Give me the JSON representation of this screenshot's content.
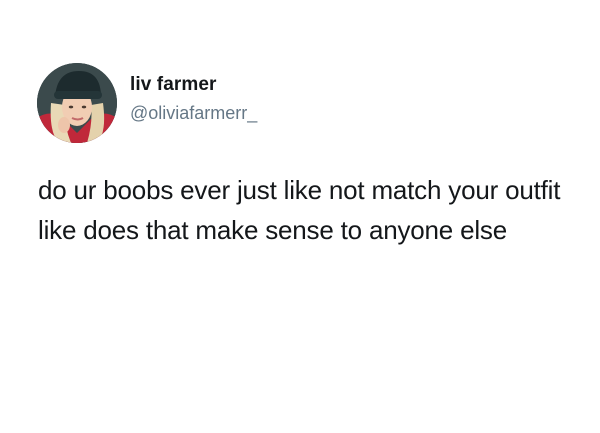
{
  "tweet": {
    "author_name": "liv farmer",
    "author_handle": "@oliviafarmerr_",
    "text": "do ur boobs ever just like not match your outfit like does that make sense to anyone else",
    "avatar_icon": "profile-photo"
  },
  "colors": {
    "background": "#ffffff",
    "text": "#14171a",
    "handle": "#657786"
  }
}
